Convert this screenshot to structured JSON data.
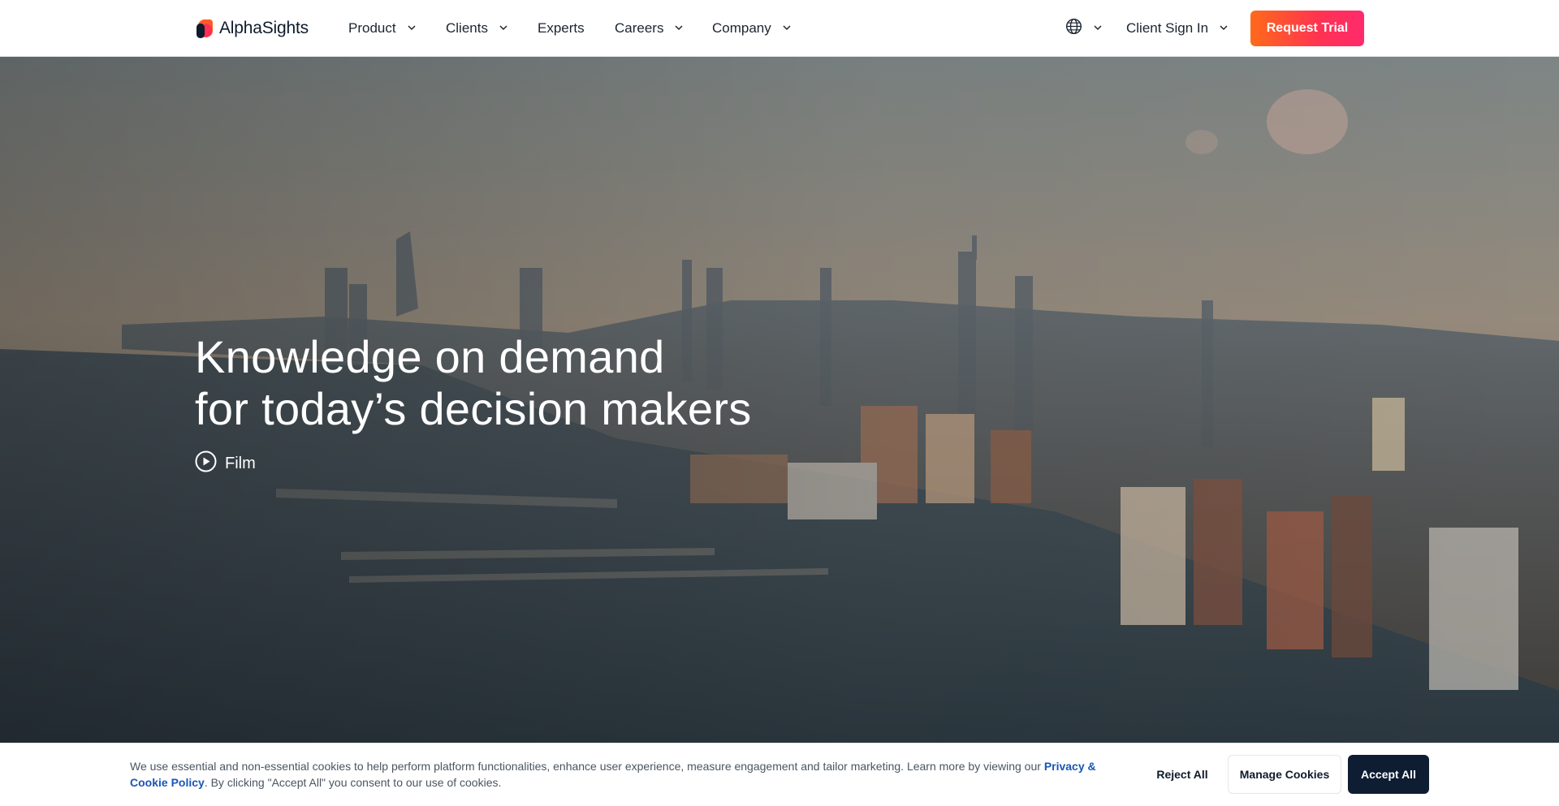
{
  "header": {
    "brand": "AlphaSights",
    "nav": [
      {
        "label": "Product",
        "dropdown": true
      },
      {
        "label": "Clients",
        "dropdown": true
      },
      {
        "label": "Experts",
        "dropdown": false
      },
      {
        "label": "Careers",
        "dropdown": true
      },
      {
        "label": "Company",
        "dropdown": true
      }
    ],
    "language_icon": "globe-icon",
    "client_sign_in": "Client Sign In",
    "request_trial": "Request Trial"
  },
  "hero": {
    "title_line1": "Knowledge on demand",
    "title_line2": "for today’s decision makers",
    "film_label": "Film",
    "film_icon": "play-circle-icon"
  },
  "cookie_banner": {
    "text_before": "We use essential and non-essential cookies to help perform platform functionalities, enhance user experience, measure engagement and tailor marketing. Learn more by viewing our ",
    "link_text": "Privacy & Cookie Policy",
    "text_after": ". By clicking \"Accept All\" you consent to our use of cookies.",
    "reject_label": "Reject All",
    "manage_label": "Manage Cookies",
    "accept_label": "Accept All"
  },
  "colors": {
    "brand_orange": "#ff6a1a",
    "brand_pink": "#ff2a6d",
    "navy": "#0f1d33",
    "link_blue": "#1a56b5"
  }
}
